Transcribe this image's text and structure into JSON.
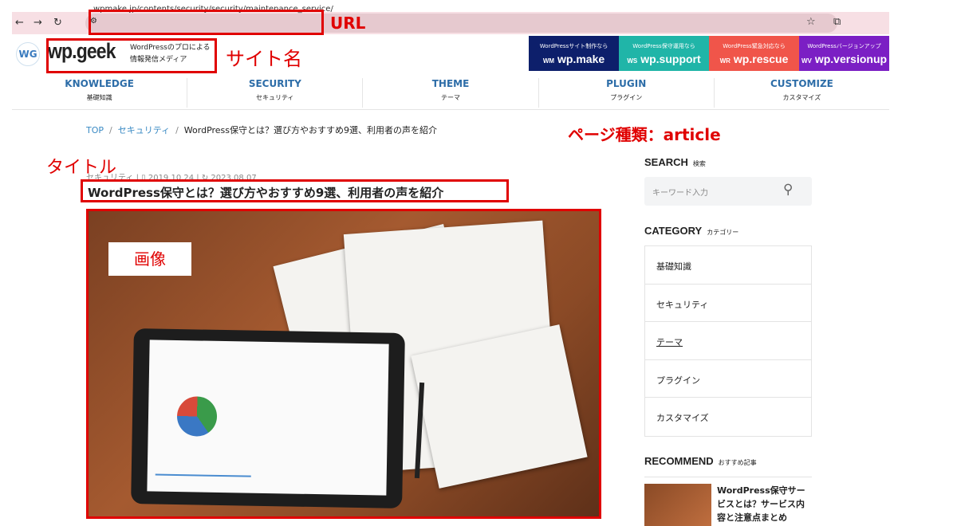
{
  "browser": {
    "url": "wpmake.jp/contents/security/security/maintenance_service/"
  },
  "annotations": {
    "url": "URL",
    "site_name": "サイト名",
    "page_type": "ページ種類：article",
    "title": "タイトル",
    "image": "画像"
  },
  "site": {
    "logo": "WG",
    "name": "wp.geek",
    "tagline1": "WordPressのプロによる",
    "tagline2": "情報発信メディア"
  },
  "banners": [
    {
      "sub": "WordPressサイト制作なら",
      "abbr": "WM",
      "name": "wp.make",
      "color": "#0d1f6b"
    },
    {
      "sub": "WordPress保守運用なら",
      "abbr": "WS",
      "name": "wp.support",
      "color": "#20b5a8"
    },
    {
      "sub": "WordPress緊急対応なら",
      "abbr": "WR",
      "name": "wp.rescue",
      "color": "#f0554a"
    },
    {
      "sub": "WordPressバージョンアップ",
      "abbr": "WV",
      "name": "wp.versionup",
      "color": "#7b1fc4"
    }
  ],
  "nav": [
    {
      "en": "KNOWLEDGE",
      "ja": "基礎知識"
    },
    {
      "en": "SECURITY",
      "ja": "セキュリティ"
    },
    {
      "en": "THEME",
      "ja": "テーマ"
    },
    {
      "en": "PLUGIN",
      "ja": "プラグイン"
    },
    {
      "en": "CUSTOMIZE",
      "ja": "カスタマイズ"
    }
  ],
  "breadcrumb": {
    "top": "TOP",
    "category": "セキュリティ",
    "current": "WordPress保守とは？選び方やおすすめ9選、利用者の声を紹介"
  },
  "article": {
    "category": "セキュリティ",
    "published": "2019.10.24",
    "updated": "2023.08.07",
    "title": "WordPress保守とは？選び方やおすすめ9選、利用者の声を紹介"
  },
  "sidebar": {
    "search": {
      "heading": "SEARCH",
      "sub": "検索",
      "placeholder": "キーワード入力"
    },
    "category": {
      "heading": "CATEGORY",
      "sub": "カテゴリー",
      "items": [
        "基礎知識",
        "セキュリティ",
        "テーマ",
        "プラグイン",
        "カスタマイズ"
      ]
    },
    "recommend": {
      "heading": "RECOMMEND",
      "sub": "おすすめ記事",
      "item_title": "WordPress保守サービスとは？サービス内容と注意点まとめ"
    }
  }
}
